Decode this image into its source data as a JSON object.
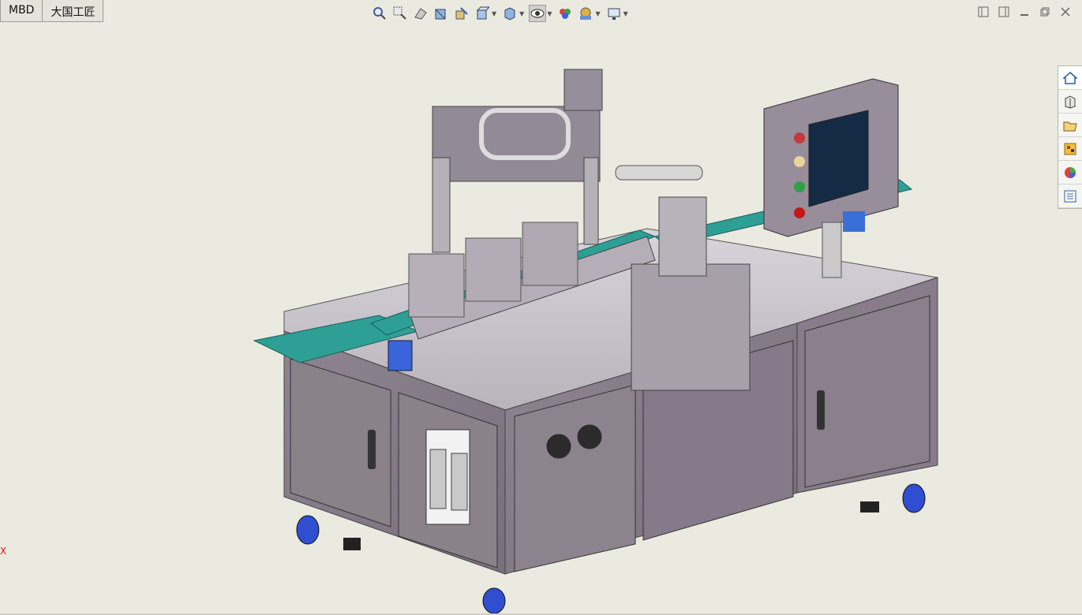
{
  "tabs": [
    {
      "label": "MBD"
    },
    {
      "label": "大国工匠"
    }
  ],
  "hud_tools": [
    {
      "name": "zoom-to-fit-icon"
    },
    {
      "name": "zoom-to-area-icon"
    },
    {
      "name": "previous-view-icon"
    },
    {
      "name": "section-view-icon"
    },
    {
      "name": "dynamic-annotation-icon"
    },
    {
      "name": "view-orientation-icon"
    },
    {
      "name": "display-style-icon"
    },
    {
      "name": "hide-show-items-icon"
    },
    {
      "name": "edit-appearance-icon"
    },
    {
      "name": "apply-scene-icon"
    },
    {
      "name": "view-settings-icon"
    }
  ],
  "task_pane": [
    {
      "name": "home-icon"
    },
    {
      "name": "design-library-icon"
    },
    {
      "name": "file-explorer-icon"
    },
    {
      "name": "view-palette-icon"
    },
    {
      "name": "appearances-icon"
    },
    {
      "name": "custom-properties-icon"
    }
  ],
  "triad": {
    "label": "X"
  },
  "colors": {
    "background": "#ebeae0",
    "machine_frame": "#8c7f8c",
    "conveyor_belt": "#2e9f95",
    "accent_blue": "#2f4fd0"
  }
}
